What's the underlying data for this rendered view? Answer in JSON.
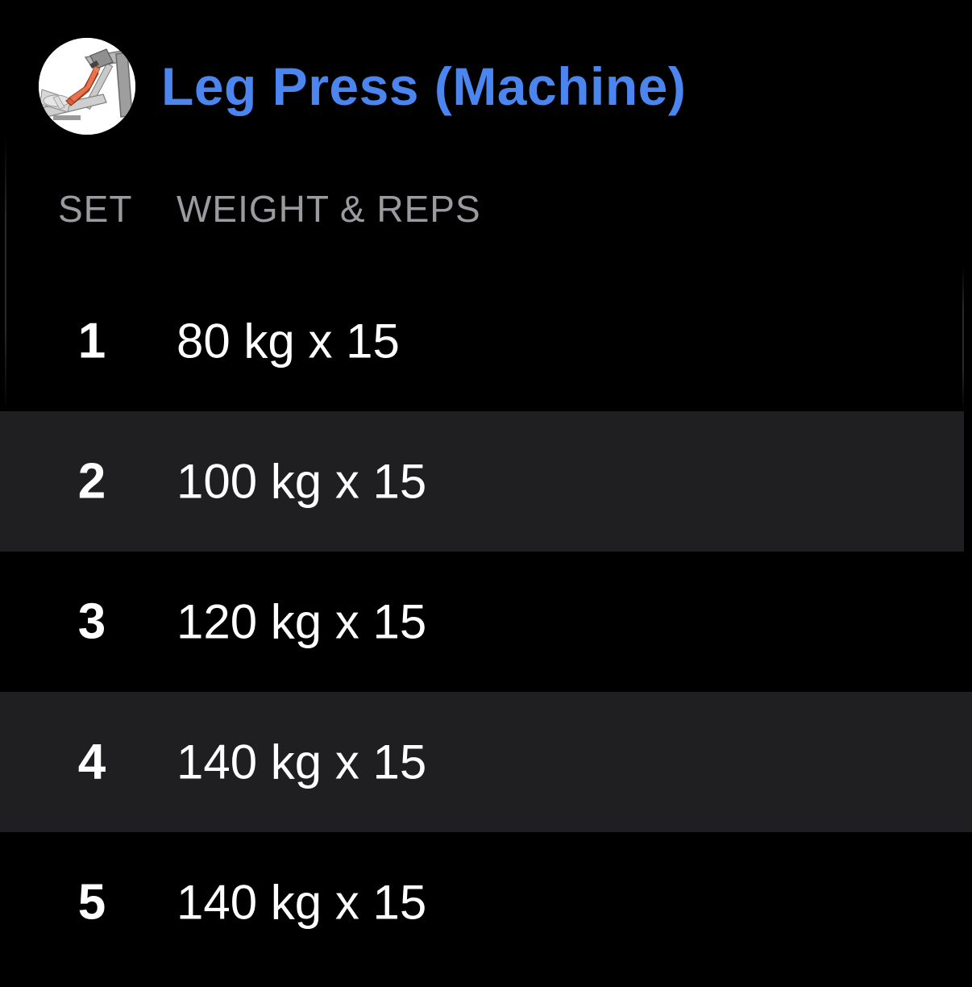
{
  "exercise": {
    "title": "Leg Press (Machine)",
    "thumbnail_icon": "leg-press-machine-icon",
    "title_color": "#4a85f0"
  },
  "columns": {
    "set": "SET",
    "weight_reps": "WEIGHT & REPS"
  },
  "sets": [
    {
      "number": "1",
      "value": "80 kg x 15"
    },
    {
      "number": "2",
      "value": "100 kg x 15"
    },
    {
      "number": "3",
      "value": "120 kg x 15"
    },
    {
      "number": "4",
      "value": "140 kg x 15"
    },
    {
      "number": "5",
      "value": "140 kg x 15"
    }
  ],
  "colors": {
    "background": "#000000",
    "alt_row": "#1f1f21",
    "header_text": "#9a9aa0"
  }
}
